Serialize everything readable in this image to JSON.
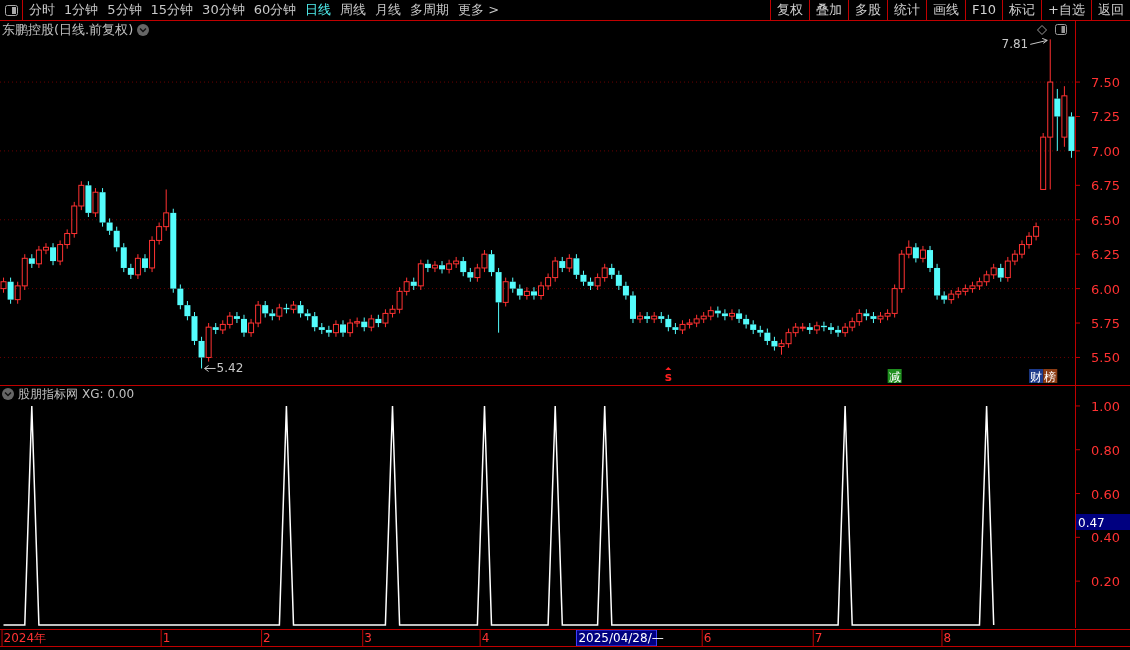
{
  "toolbar": {
    "periods": [
      {
        "label": "分时",
        "selected": false
      },
      {
        "label": "1分钟",
        "selected": false
      },
      {
        "label": "5分钟",
        "selected": false
      },
      {
        "label": "15分钟",
        "selected": false
      },
      {
        "label": "30分钟",
        "selected": false
      },
      {
        "label": "60分钟",
        "selected": false
      },
      {
        "label": "日线",
        "selected": true
      },
      {
        "label": "周线",
        "selected": false
      },
      {
        "label": "月线",
        "selected": false
      },
      {
        "label": "多周期",
        "selected": false
      },
      {
        "label": "更多 >",
        "selected": false
      }
    ],
    "buttons": [
      "复权",
      "叠加",
      "多股",
      "统计",
      "画线",
      "F10",
      "标记",
      "+自选",
      "返回"
    ]
  },
  "main_panel": {
    "title": "东鹏控股(日线.前复权)",
    "chart_data": {
      "type": "candlestick",
      "grid": true,
      "ylim": [
        5.3,
        7.82
      ],
      "yticks": [
        {
          "value": 5.5,
          "label": "5.50"
        },
        {
          "value": 5.75,
          "label": "5.75"
        },
        {
          "value": 6.0,
          "label": "6.00"
        },
        {
          "value": 6.25,
          "label": "6.25"
        },
        {
          "value": 6.5,
          "label": "6.50"
        },
        {
          "value": 6.75,
          "label": "6.75"
        },
        {
          "value": 7.0,
          "label": "7.00"
        },
        {
          "value": 7.25,
          "label": "7.25"
        },
        {
          "value": 7.5,
          "label": "7.50"
        }
      ],
      "categories": [
        null,
        null,
        null,
        null,
        null,
        null,
        null,
        null,
        null,
        null,
        null,
        null,
        null,
        null,
        null,
        null,
        null,
        null,
        null,
        null,
        null,
        null,
        null,
        null,
        null,
        null,
        null,
        null,
        null,
        null,
        null,
        null,
        null,
        null,
        null,
        null,
        null,
        null,
        null,
        null,
        null,
        null,
        null,
        null,
        null,
        null,
        null,
        null,
        null,
        null,
        null,
        null,
        null,
        null,
        null,
        null,
        null,
        null,
        null,
        null,
        null,
        null,
        null,
        null,
        null,
        null,
        null,
        null,
        null,
        null,
        null,
        null,
        null,
        null,
        null,
        null,
        null,
        null,
        null,
        null,
        null,
        null,
        null,
        null,
        null,
        null,
        null,
        null,
        null,
        null,
        null,
        null,
        null,
        null,
        null,
        null,
        null,
        null,
        null,
        null,
        null,
        null,
        null,
        null,
        null,
        null,
        null,
        null,
        null,
        null,
        null,
        null,
        null,
        null,
        null,
        null,
        null,
        null,
        null,
        null,
        null,
        null,
        null,
        null,
        null,
        null,
        null,
        null,
        null,
        null,
        null,
        null,
        null,
        null,
        null,
        null,
        null,
        null,
        null,
        null,
        null,
        null,
        null,
        null,
        null,
        null,
        null,
        null,
        null,
        null,
        null,
        null
      ],
      "ohlc": [
        [
          6.0,
          6.08,
          5.97,
          6.05
        ],
        [
          6.05,
          6.08,
          5.89,
          5.92
        ],
        [
          5.92,
          6.05,
          5.89,
          6.02
        ],
        [
          6.02,
          6.25,
          5.99,
          6.22
        ],
        [
          6.22,
          6.25,
          6.15,
          6.18
        ],
        [
          6.18,
          6.31,
          6.15,
          6.28
        ],
        [
          6.28,
          6.33,
          6.25,
          6.3
        ],
        [
          6.3,
          6.33,
          6.17,
          6.2
        ],
        [
          6.2,
          6.35,
          6.17,
          6.32
        ],
        [
          6.32,
          6.43,
          6.29,
          6.4
        ],
        [
          6.4,
          6.63,
          6.37,
          6.6
        ],
        [
          6.6,
          6.78,
          6.57,
          6.75
        ],
        [
          6.75,
          6.78,
          6.52,
          6.55
        ],
        [
          6.55,
          6.73,
          6.52,
          6.7
        ],
        [
          6.7,
          6.73,
          6.45,
          6.48
        ],
        [
          6.48,
          6.51,
          6.39,
          6.42
        ],
        [
          6.42,
          6.45,
          6.27,
          6.3
        ],
        [
          6.3,
          6.33,
          6.12,
          6.15
        ],
        [
          6.15,
          6.18,
          6.07,
          6.1
        ],
        [
          6.1,
          6.25,
          6.07,
          6.22
        ],
        [
          6.22,
          6.25,
          6.12,
          6.15
        ],
        [
          6.15,
          6.38,
          6.12,
          6.35
        ],
        [
          6.35,
          6.48,
          6.32,
          6.45
        ],
        [
          6.45,
          6.72,
          6.42,
          6.55
        ],
        [
          6.55,
          6.58,
          5.97,
          6.0
        ],
        [
          6.0,
          6.03,
          5.85,
          5.88
        ],
        [
          5.88,
          5.91,
          5.77,
          5.8
        ],
        [
          5.8,
          5.83,
          5.59,
          5.62
        ],
        [
          5.62,
          5.65,
          5.42,
          5.5
        ],
        [
          5.5,
          5.75,
          5.47,
          5.72
        ],
        [
          5.72,
          5.75,
          5.67,
          5.7
        ],
        [
          5.7,
          5.77,
          5.67,
          5.74
        ],
        [
          5.74,
          5.83,
          5.71,
          5.8
        ],
        [
          5.8,
          5.83,
          5.75,
          5.78
        ],
        [
          5.78,
          5.81,
          5.65,
          5.68
        ],
        [
          5.68,
          5.78,
          5.65,
          5.75
        ],
        [
          5.75,
          5.91,
          5.72,
          5.88
        ],
        [
          5.88,
          5.91,
          5.79,
          5.82
        ],
        [
          5.82,
          5.85,
          5.77,
          5.8
        ],
        [
          5.8,
          5.89,
          5.77,
          5.86
        ],
        [
          5.86,
          5.89,
          5.82,
          5.85
        ],
        [
          5.85,
          5.91,
          5.82,
          5.88
        ],
        [
          5.88,
          5.91,
          5.79,
          5.82
        ],
        [
          5.82,
          5.85,
          5.77,
          5.8
        ],
        [
          5.8,
          5.83,
          5.69,
          5.72
        ],
        [
          5.72,
          5.75,
          5.67,
          5.7
        ],
        [
          5.7,
          5.73,
          5.65,
          5.68
        ],
        [
          5.68,
          5.77,
          5.65,
          5.74
        ],
        [
          5.74,
          5.77,
          5.65,
          5.68
        ],
        [
          5.68,
          5.78,
          5.65,
          5.75
        ],
        [
          5.75,
          5.79,
          5.72,
          5.76
        ],
        [
          5.76,
          5.79,
          5.69,
          5.72
        ],
        [
          5.72,
          5.81,
          5.69,
          5.78
        ],
        [
          5.78,
          5.81,
          5.72,
          5.75
        ],
        [
          5.75,
          5.85,
          5.72,
          5.82
        ],
        [
          5.82,
          5.88,
          5.79,
          5.85
        ],
        [
          5.85,
          6.01,
          5.82,
          5.98
        ],
        [
          5.98,
          6.08,
          5.95,
          6.05
        ],
        [
          6.05,
          6.08,
          5.99,
          6.02
        ],
        [
          6.02,
          6.21,
          5.99,
          6.18
        ],
        [
          6.18,
          6.21,
          6.12,
          6.15
        ],
        [
          6.15,
          6.2,
          6.12,
          6.17
        ],
        [
          6.17,
          6.2,
          6.11,
          6.14
        ],
        [
          6.14,
          6.21,
          6.11,
          6.18
        ],
        [
          6.18,
          6.23,
          6.15,
          6.2
        ],
        [
          6.2,
          6.23,
          6.09,
          6.12
        ],
        [
          6.12,
          6.15,
          6.05,
          6.08
        ],
        [
          6.08,
          6.18,
          6.05,
          6.15
        ],
        [
          6.15,
          6.28,
          6.12,
          6.25
        ],
        [
          6.25,
          6.28,
          6.09,
          6.12
        ],
        [
          6.12,
          6.15,
          5.68,
          5.9
        ],
        [
          5.9,
          6.08,
          5.87,
          6.05
        ],
        [
          6.05,
          6.08,
          5.97,
          6.0
        ],
        [
          6.0,
          6.03,
          5.92,
          5.95
        ],
        [
          5.95,
          6.01,
          5.92,
          5.98
        ],
        [
          5.98,
          6.01,
          5.92,
          5.95
        ],
        [
          5.95,
          6.05,
          5.92,
          6.02
        ],
        [
          6.02,
          6.11,
          5.99,
          6.08
        ],
        [
          6.08,
          6.23,
          6.05,
          6.2
        ],
        [
          6.2,
          6.23,
          6.12,
          6.15
        ],
        [
          6.15,
          6.25,
          6.12,
          6.22
        ],
        [
          6.22,
          6.25,
          6.07,
          6.1
        ],
        [
          6.1,
          6.13,
          6.02,
          6.05
        ],
        [
          6.05,
          6.08,
          5.99,
          6.02
        ],
        [
          6.02,
          6.11,
          5.99,
          6.08
        ],
        [
          6.08,
          6.18,
          6.05,
          6.15
        ],
        [
          6.15,
          6.18,
          6.07,
          6.1
        ],
        [
          6.1,
          6.13,
          5.99,
          6.02
        ],
        [
          6.02,
          6.05,
          5.92,
          5.95
        ],
        [
          5.95,
          5.98,
          5.75,
          5.78
        ],
        [
          5.78,
          5.83,
          5.75,
          5.8
        ],
        [
          5.8,
          5.83,
          5.75,
          5.78
        ],
        [
          5.78,
          5.83,
          5.75,
          5.8
        ],
        [
          5.8,
          5.83,
          5.75,
          5.78
        ],
        [
          5.78,
          5.81,
          5.69,
          5.72
        ],
        [
          5.72,
          5.75,
          5.67,
          5.7
        ],
        [
          5.7,
          5.77,
          5.67,
          5.74
        ],
        [
          5.74,
          5.78,
          5.71,
          5.75
        ],
        [
          5.75,
          5.81,
          5.72,
          5.78
        ],
        [
          5.78,
          5.83,
          5.75,
          5.8
        ],
        [
          5.8,
          5.87,
          5.77,
          5.84
        ],
        [
          5.84,
          5.87,
          5.79,
          5.82
        ],
        [
          5.82,
          5.85,
          5.77,
          5.8
        ],
        [
          5.8,
          5.85,
          5.77,
          5.82
        ],
        [
          5.82,
          5.85,
          5.75,
          5.78
        ],
        [
          5.78,
          5.81,
          5.71,
          5.74
        ],
        [
          5.74,
          5.77,
          5.67,
          5.7
        ],
        [
          5.7,
          5.73,
          5.65,
          5.68
        ],
        [
          5.68,
          5.71,
          5.59,
          5.62
        ],
        [
          5.62,
          5.65,
          5.55,
          5.58
        ],
        [
          5.58,
          5.63,
          5.52,
          5.6
        ],
        [
          5.6,
          5.71,
          5.57,
          5.68
        ],
        [
          5.68,
          5.75,
          5.65,
          5.72
        ],
        [
          5.72,
          5.75,
          5.69,
          5.72
        ],
        [
          5.72,
          5.75,
          5.67,
          5.7
        ],
        [
          5.7,
          5.76,
          5.67,
          5.73
        ],
        [
          5.73,
          5.76,
          5.69,
          5.72
        ],
        [
          5.72,
          5.75,
          5.67,
          5.7
        ],
        [
          5.7,
          5.73,
          5.65,
          5.68
        ],
        [
          5.68,
          5.75,
          5.65,
          5.72
        ],
        [
          5.72,
          5.79,
          5.69,
          5.76
        ],
        [
          5.76,
          5.85,
          5.73,
          5.82
        ],
        [
          5.82,
          5.85,
          5.77,
          5.8
        ],
        [
          5.8,
          5.83,
          5.75,
          5.78
        ],
        [
          5.78,
          5.83,
          5.75,
          5.8
        ],
        [
          5.8,
          5.85,
          5.77,
          5.82
        ],
        [
          5.82,
          6.03,
          5.79,
          6.0
        ],
        [
          6.0,
          6.28,
          5.97,
          6.25
        ],
        [
          6.25,
          6.35,
          6.22,
          6.3
        ],
        [
          6.3,
          6.33,
          6.19,
          6.22
        ],
        [
          6.22,
          6.31,
          6.19,
          6.28
        ],
        [
          6.28,
          6.31,
          6.12,
          6.15
        ],
        [
          6.15,
          6.18,
          5.92,
          5.95
        ],
        [
          5.95,
          5.98,
          5.89,
          5.92
        ],
        [
          5.92,
          5.99,
          5.89,
          5.96
        ],
        [
          5.96,
          6.01,
          5.93,
          5.98
        ],
        [
          5.98,
          6.03,
          5.95,
          6.0
        ],
        [
          6.0,
          6.05,
          5.97,
          6.02
        ],
        [
          6.02,
          6.08,
          5.99,
          6.05
        ],
        [
          6.05,
          6.13,
          6.02,
          6.1
        ],
        [
          6.1,
          6.18,
          6.07,
          6.15
        ],
        [
          6.15,
          6.18,
          6.05,
          6.08
        ],
        [
          6.08,
          6.23,
          6.05,
          6.2
        ],
        [
          6.2,
          6.28,
          6.17,
          6.25
        ],
        [
          6.25,
          6.35,
          6.22,
          6.32
        ],
        [
          6.32,
          6.41,
          6.29,
          6.38
        ],
        [
          6.38,
          6.48,
          6.35,
          6.45
        ],
        [
          6.72,
          7.13,
          6.72,
          7.1
        ],
        [
          7.1,
          7.81,
          6.72,
          7.5
        ],
        [
          7.38,
          7.45,
          7.0,
          7.25
        ],
        [
          7.1,
          7.47,
          7.03,
          7.4
        ],
        [
          7.25,
          7.28,
          6.95,
          7.0
        ]
      ],
      "annotations": [
        "7.81",
        "5.42"
      ]
    },
    "events": [
      {
        "kind": "signal",
        "label": "s",
        "color": "#ff2020"
      },
      {
        "kind": "tag",
        "label": "减",
        "color": "#1f8f1f"
      },
      {
        "kind": "tag",
        "label": "财",
        "color": "#1c3a8c"
      },
      {
        "kind": "tag",
        "label": "榜",
        "color": "#8c3c14"
      }
    ]
  },
  "indicator_panel": {
    "title": "股朋指标网",
    "reading": "XG: 0.00",
    "cursor": {
      "date": "2025/04/28/—",
      "value": "0.47"
    },
    "chart_data": {
      "type": "line",
      "ylim": [
        -0.014,
        1.018
      ],
      "yticks": [
        {
          "value": 0.2,
          "label": "0.20"
        },
        {
          "value": 0.4,
          "label": "0.40"
        },
        {
          "value": 0.6,
          "label": "0.60"
        },
        {
          "value": 0.8,
          "label": "0.80"
        },
        {
          "value": 1.0,
          "label": "1.00"
        }
      ],
      "categories": [
        null,
        null,
        null,
        null,
        null,
        null,
        null,
        null,
        null,
        null,
        null,
        null,
        null,
        null,
        null,
        null,
        null,
        null,
        null,
        null,
        null,
        null,
        null,
        null,
        null,
        null,
        null,
        null,
        null,
        null,
        null,
        null,
        null,
        null,
        null,
        null,
        null,
        null,
        null,
        null,
        null,
        null,
        null,
        null,
        null,
        null,
        null,
        null,
        null,
        null,
        null,
        null,
        null,
        null,
        null,
        null,
        null,
        null,
        null,
        null,
        null,
        null,
        null,
        null,
        null,
        null,
        null,
        null,
        null,
        null,
        null,
        null,
        null,
        null,
        null,
        null,
        null,
        null,
        null,
        null,
        null,
        null,
        null,
        null,
        null,
        null,
        null,
        null,
        null,
        null,
        null,
        null,
        null,
        null,
        null,
        null,
        null,
        null,
        null,
        null,
        null,
        null,
        null,
        null,
        null,
        null,
        null,
        null,
        null,
        null,
        null,
        null,
        null,
        null,
        null,
        null,
        null,
        null,
        null,
        null,
        null,
        null,
        null,
        null,
        null,
        null,
        null,
        null,
        null,
        null,
        null,
        null,
        null,
        null,
        null,
        null,
        null,
        null,
        null,
        null,
        null,
        null,
        null,
        null,
        null,
        null,
        null,
        null,
        null,
        null,
        null,
        null
      ],
      "series": [
        {
          "color": "#ffffff",
          "values": [
            0,
            0,
            0,
            0,
            1,
            0,
            0,
            0,
            0,
            0,
            0,
            0,
            0,
            0,
            0,
            0,
            0,
            0,
            0,
            0,
            0,
            0,
            0,
            0,
            0,
            0,
            0,
            0,
            0,
            0,
            0,
            0,
            0,
            0,
            0,
            0,
            0,
            0,
            0,
            0,
            1,
            0,
            0,
            0,
            0,
            0,
            0,
            0,
            0,
            0,
            0,
            0,
            0,
            0,
            0,
            1,
            0,
            0,
            0,
            0,
            0,
            0,
            0,
            0,
            0,
            0,
            0,
            0,
            1,
            0,
            0,
            0,
            0,
            0,
            0,
            0,
            0,
            0,
            1,
            0,
            0,
            0,
            0,
            0,
            0,
            1,
            0,
            0,
            0,
            0,
            0,
            0,
            0,
            0,
            0,
            0,
            0,
            0,
            0,
            0,
            0,
            0,
            0,
            0,
            0,
            0,
            0,
            0,
            0,
            0,
            0,
            0,
            0,
            0,
            0,
            0,
            0,
            0,
            0,
            1,
            0,
            0,
            0,
            0,
            0,
            0,
            0,
            0,
            0,
            0,
            0,
            0,
            0,
            0,
            0,
            0,
            0,
            0,
            0,
            1,
            0,
            null,
            null,
            null,
            null,
            null,
            null,
            null,
            null,
            null,
            null,
            null
          ]
        }
      ]
    },
    "time_axis": {
      "labels": [
        "2024年",
        "1",
        "2",
        "3",
        "4",
        "6",
        "7",
        "8"
      ]
    }
  }
}
